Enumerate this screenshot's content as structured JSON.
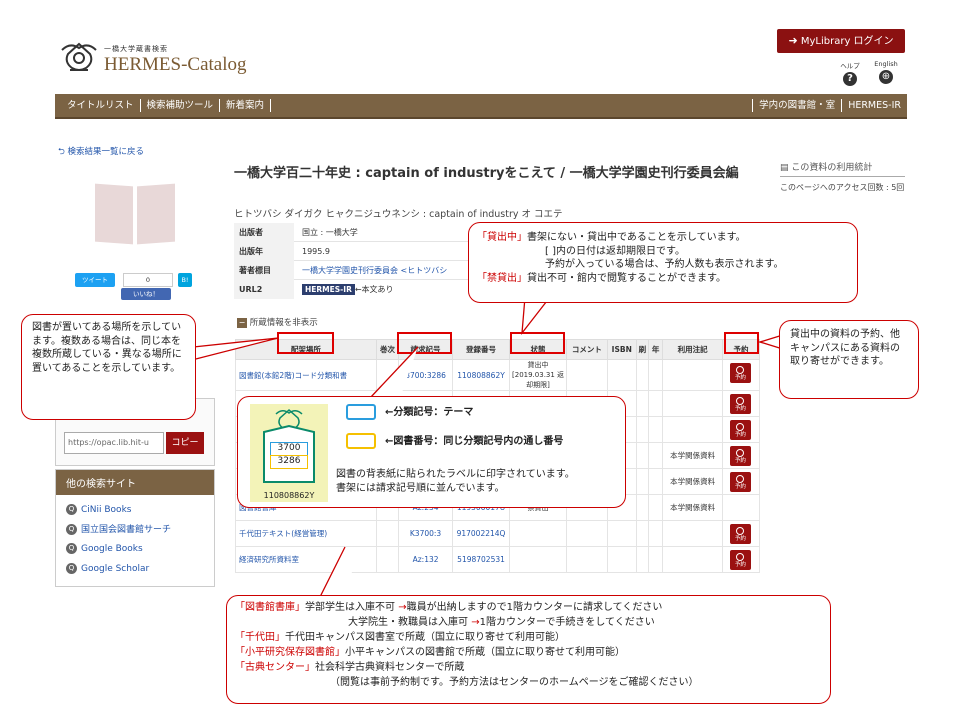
{
  "header": {
    "logo_small": "一橋大学蔵書検索",
    "logo_main": "HERMES-Catalog",
    "login": "MyLibrary ログイン",
    "help": "ヘルプ",
    "english": "English"
  },
  "nav": {
    "items": [
      "タイトルリスト",
      "検索補助ツール",
      "新着案内"
    ],
    "right": [
      "学内の図書館・室",
      "HERMES-IR"
    ]
  },
  "back_link": "検索結果一覧に戻る",
  "social": {
    "tweet": "ツイート",
    "count": "0",
    "b": "B!",
    "like": "いいね！"
  },
  "book": {
    "title": "一橋大学百二十年史 : captain of industryをこえて / 一橋大学学園史刊行委員会編",
    "reading": "ヒトツバシ ダイガク ヒャクニジュウネンシ : captain of industry オ コエテ",
    "meta": [
      {
        "k": "出版者",
        "v": "国立 : 一橋大学"
      },
      {
        "k": "出版年",
        "v": "1995.9"
      },
      {
        "k": "著者標目",
        "v": "一橋大学学園史刊行委員会 <ヒトツバシ"
      },
      {
        "k": "URL2",
        "v": "HERMES-IR",
        "v2": "←本文あり"
      }
    ]
  },
  "stats": {
    "title": "この資料の利用統計",
    "text": "このページへのアクセス回数 : 5回"
  },
  "holdings": {
    "toggle": "所蔵情報を非表示",
    "columns": [
      "配架場所",
      "巻次",
      "請求記号",
      "登録番号",
      "状態",
      "コメント",
      "ISBN",
      "刷",
      "年",
      "利用注記",
      "予約"
    ],
    "rows": [
      {
        "loc": "図書館(本館2階)コード分類和書",
        "call": "3700:3286",
        "reg": "110808862Y",
        "status": "貸出中 [2019.03.31 返却期限]",
        "note": "",
        "res": true
      },
      {
        "loc": "",
        "call": "",
        "reg": "",
        "status": "",
        "note": "",
        "res": true
      },
      {
        "loc": "",
        "call": "",
        "reg": "",
        "status": "",
        "note": "",
        "res": true
      },
      {
        "loc": "",
        "call": "",
        "reg": "",
        "status": "",
        "note": "本学関係資料",
        "res": true
      },
      {
        "loc": "",
        "call": "",
        "reg": "",
        "status": "",
        "note": "本学関係資料",
        "res": true
      },
      {
        "loc": "図書館書庫",
        "call": "Az:234",
        "reg": "119506017U",
        "status": "禁貸出",
        "note": "本学関係資料",
        "res": false
      },
      {
        "loc": "千代田テキスト(経営管理)",
        "call": "K3700:3",
        "reg": "917002214Q",
        "status": "",
        "note": "",
        "res": true
      },
      {
        "loc": "経済研究所資料室",
        "call": "Az:132",
        "reg": "5198702531",
        "status": "",
        "note": "",
        "res": true
      }
    ],
    "res_label": "予約"
  },
  "sidebar": {
    "url": "https://opac.lib.hit-u",
    "copy": "コピー",
    "other_title": "他の検索サイト",
    "links": [
      "CiNii Books",
      "国立国会図書館サーチ",
      "Google Books",
      "Google Scholar"
    ]
  },
  "callouts": {
    "status": {
      "l1a": "「貸出中」",
      "l1b": "書架にない・貸出中であることを示しています。",
      "l2": "[ ]内の日付は返却期限日です。",
      "l3": "予約が入っている場合は、予約人数も表示されます。",
      "l4a": "「禁貸出」",
      "l4b": "貸出不可・館内で閲覧することができます。"
    },
    "location": "図書が置いてある場所を示しています。複数ある場合は、同じ本を複数所蔵している・異なる場所に置いてあることを示しています。",
    "reserve": "貸出中の資料の予約、他キャンパスにある資料の取り寄せができます。",
    "label": {
      "blue_text": "←分類記号：テーマ",
      "yellow_text": "←図書番号：同じ分類記号内の通し番号",
      "desc1": "図書の背表紙に貼られたラベルに印字されています。",
      "desc2": "書架には請求記号順に並んでいます。",
      "lab_top": "3700",
      "lab_bottom": "3286",
      "lab_reg": "110808862Y"
    },
    "bottom": {
      "r1a": "「図書館書庫」",
      "r1b": "学部学生は入庫不可",
      "r1c": "→",
      "r1d": "職員が出納しますので1階カウンターに請求してください",
      "r2a": "大学院生・教職員は入庫可",
      "r2b": "→",
      "r2c": "1階カウンターで手続きをしてください",
      "r3a": "「千代田」",
      "r3b": "千代田キャンパス図書室で所蔵（国立に取り寄せて利用可能）",
      "r4a": "「小平研究保存図書館」",
      "r4b": "小平キャンパスの図書館で所蔵（国立に取り寄せて利用可能）",
      "r5a": "「古典センター」",
      "r5b": "社会科学古典資料センターで所蔵",
      "r6": "（閲覧は事前予約制です。予約方法はセンターのホームページをご確認ください）"
    }
  }
}
